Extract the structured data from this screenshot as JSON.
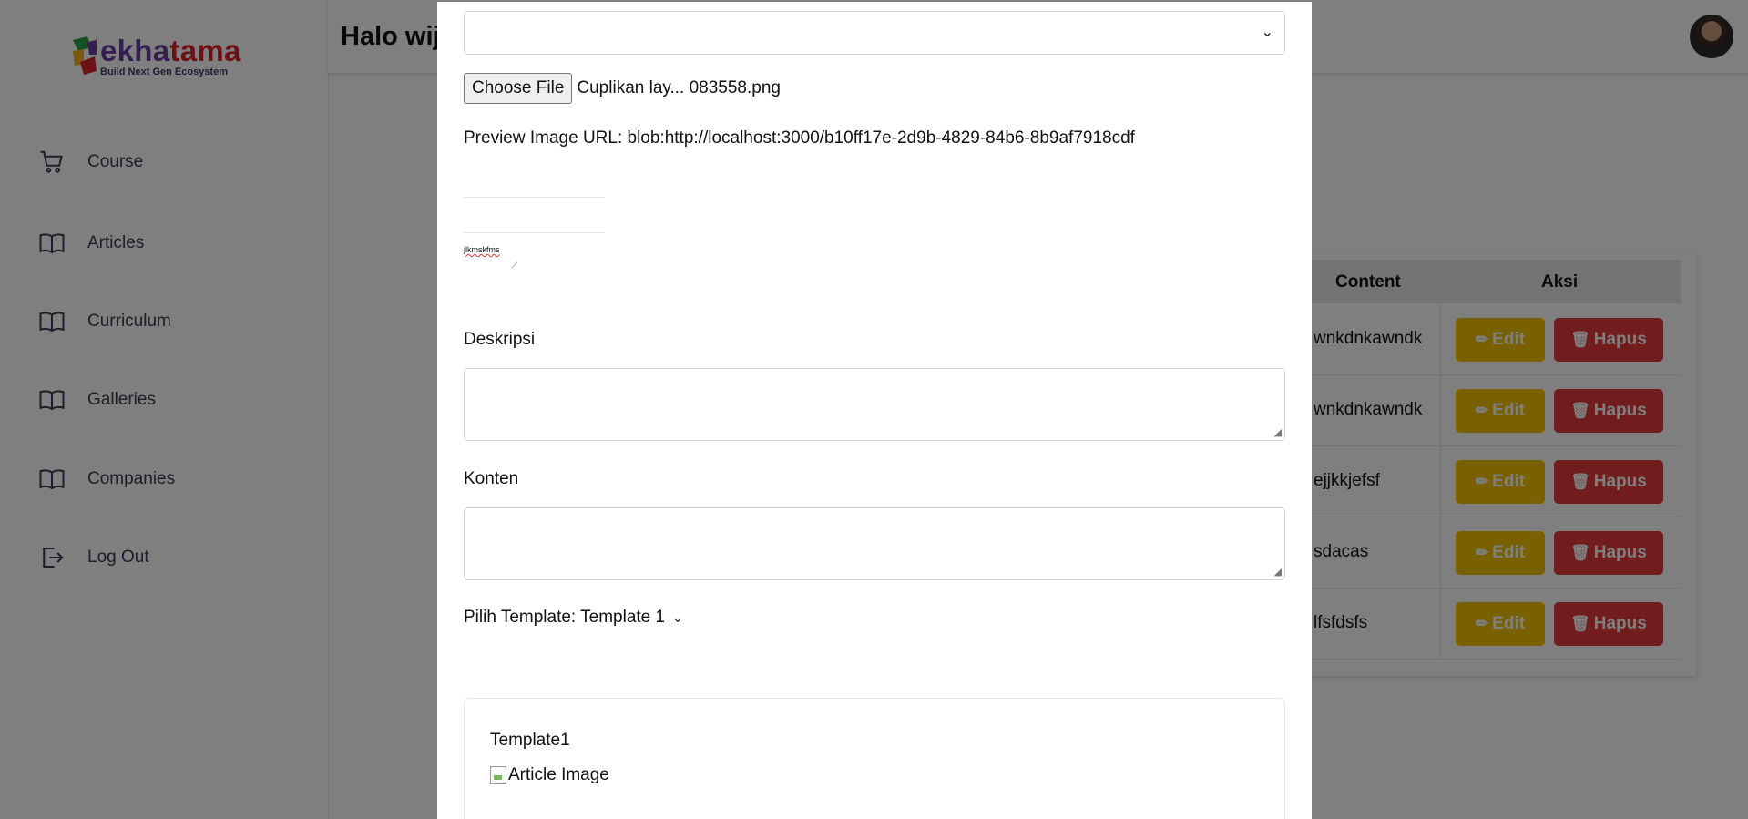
{
  "brand": {
    "name_part1": "ekha",
    "name_part2": "tama",
    "tagline": "Build Next Gen Ecosystem"
  },
  "sidebar": {
    "items": [
      {
        "label": "Course",
        "icon": "cart-icon"
      },
      {
        "label": "Articles",
        "icon": "book-icon"
      },
      {
        "label": "Curriculum",
        "icon": "book-icon"
      },
      {
        "label": "Galleries",
        "icon": "book-icon"
      },
      {
        "label": "Companies",
        "icon": "book-icon"
      },
      {
        "label": "Log Out",
        "icon": "logout-icon"
      }
    ]
  },
  "header": {
    "greeting": "Halo wij"
  },
  "table": {
    "columns": [
      "Content",
      "Aksi"
    ],
    "rows": [
      {
        "content": "wnkdnkawndk"
      },
      {
        "content": "wnkdnkawndk"
      },
      {
        "content": "ejjkkjefsf"
      },
      {
        "content": "sdacas"
      },
      {
        "content": "lfsfdsfs"
      }
    ],
    "edit_label": "Edit",
    "delete_label": "Hapus"
  },
  "modal": {
    "top_select_value": "",
    "choose_file_label": "Choose File",
    "file_name": "Cuplikan lay... 083558.png",
    "preview_url": "Preview Image URL: blob:http://localhost:3000/b10ff17e-2d9b-4829-84b6-8b9af7918cdf",
    "tiny_title_value": "jlkmskfms",
    "deskripsi_label": "Deskripsi",
    "deskripsi_value": "",
    "konten_label": "Konten",
    "konten_value": "",
    "template_picker_label": "Pilih Template: Template 1",
    "template_card": {
      "title": "Template1",
      "image_alt": "Article Image"
    }
  },
  "colors": {
    "edit": "#f2c200",
    "delete": "#e23b3b",
    "overlay": "rgba(0,0,0,0.5)"
  }
}
